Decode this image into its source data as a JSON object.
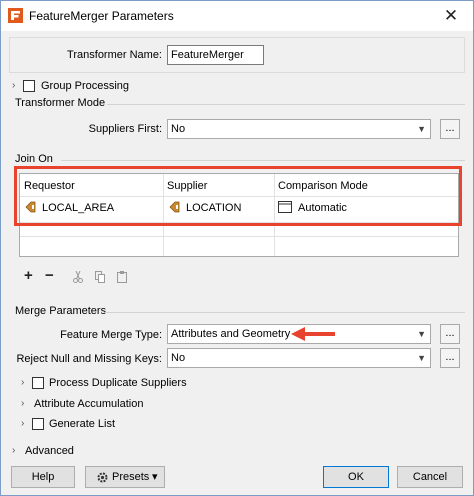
{
  "window": {
    "title": "FeatureMerger Parameters",
    "close_glyph": "✕"
  },
  "transformer": {
    "name_label": "Transformer Name:",
    "name_value": "FeatureMerger"
  },
  "group_processing": {
    "label": "Group Processing"
  },
  "transformer_mode": {
    "section_label": "Transformer Mode",
    "suppliers_first_label": "Suppliers First:",
    "suppliers_first_value": "No"
  },
  "join_on": {
    "section_label": "Join On",
    "columns": [
      "Requestor",
      "Supplier",
      "Comparison Mode"
    ],
    "rows": [
      {
        "requestor": "LOCAL_AREA",
        "supplier": "LOCATION",
        "mode": "Automatic"
      }
    ],
    "toolbar": {
      "add": "+",
      "remove": "−"
    }
  },
  "merge_parameters": {
    "section_label": "Merge Parameters",
    "feature_merge_type_label": "Feature Merge Type:",
    "feature_merge_type_value": "Attributes and Geometry",
    "reject_null_label": "Reject Null and Missing Keys:",
    "reject_null_value": "No",
    "process_duplicate_label": "Process Duplicate Suppliers",
    "attribute_accumulation_label": "Attribute Accumulation",
    "generate_list_label": "Generate List"
  },
  "advanced": {
    "label": "Advanced"
  },
  "buttons": {
    "help": "Help",
    "presets": "Presets",
    "ok": "OK",
    "cancel": "Cancel"
  },
  "colors": {
    "highlight": "#e8432e",
    "attr_icon": "#c9882f",
    "window_border": "#7a9cc6"
  },
  "icons": {
    "ellipsis": "...",
    "dropdown": "▼",
    "chevron_right": "›",
    "presets_dropdown": "▾"
  }
}
